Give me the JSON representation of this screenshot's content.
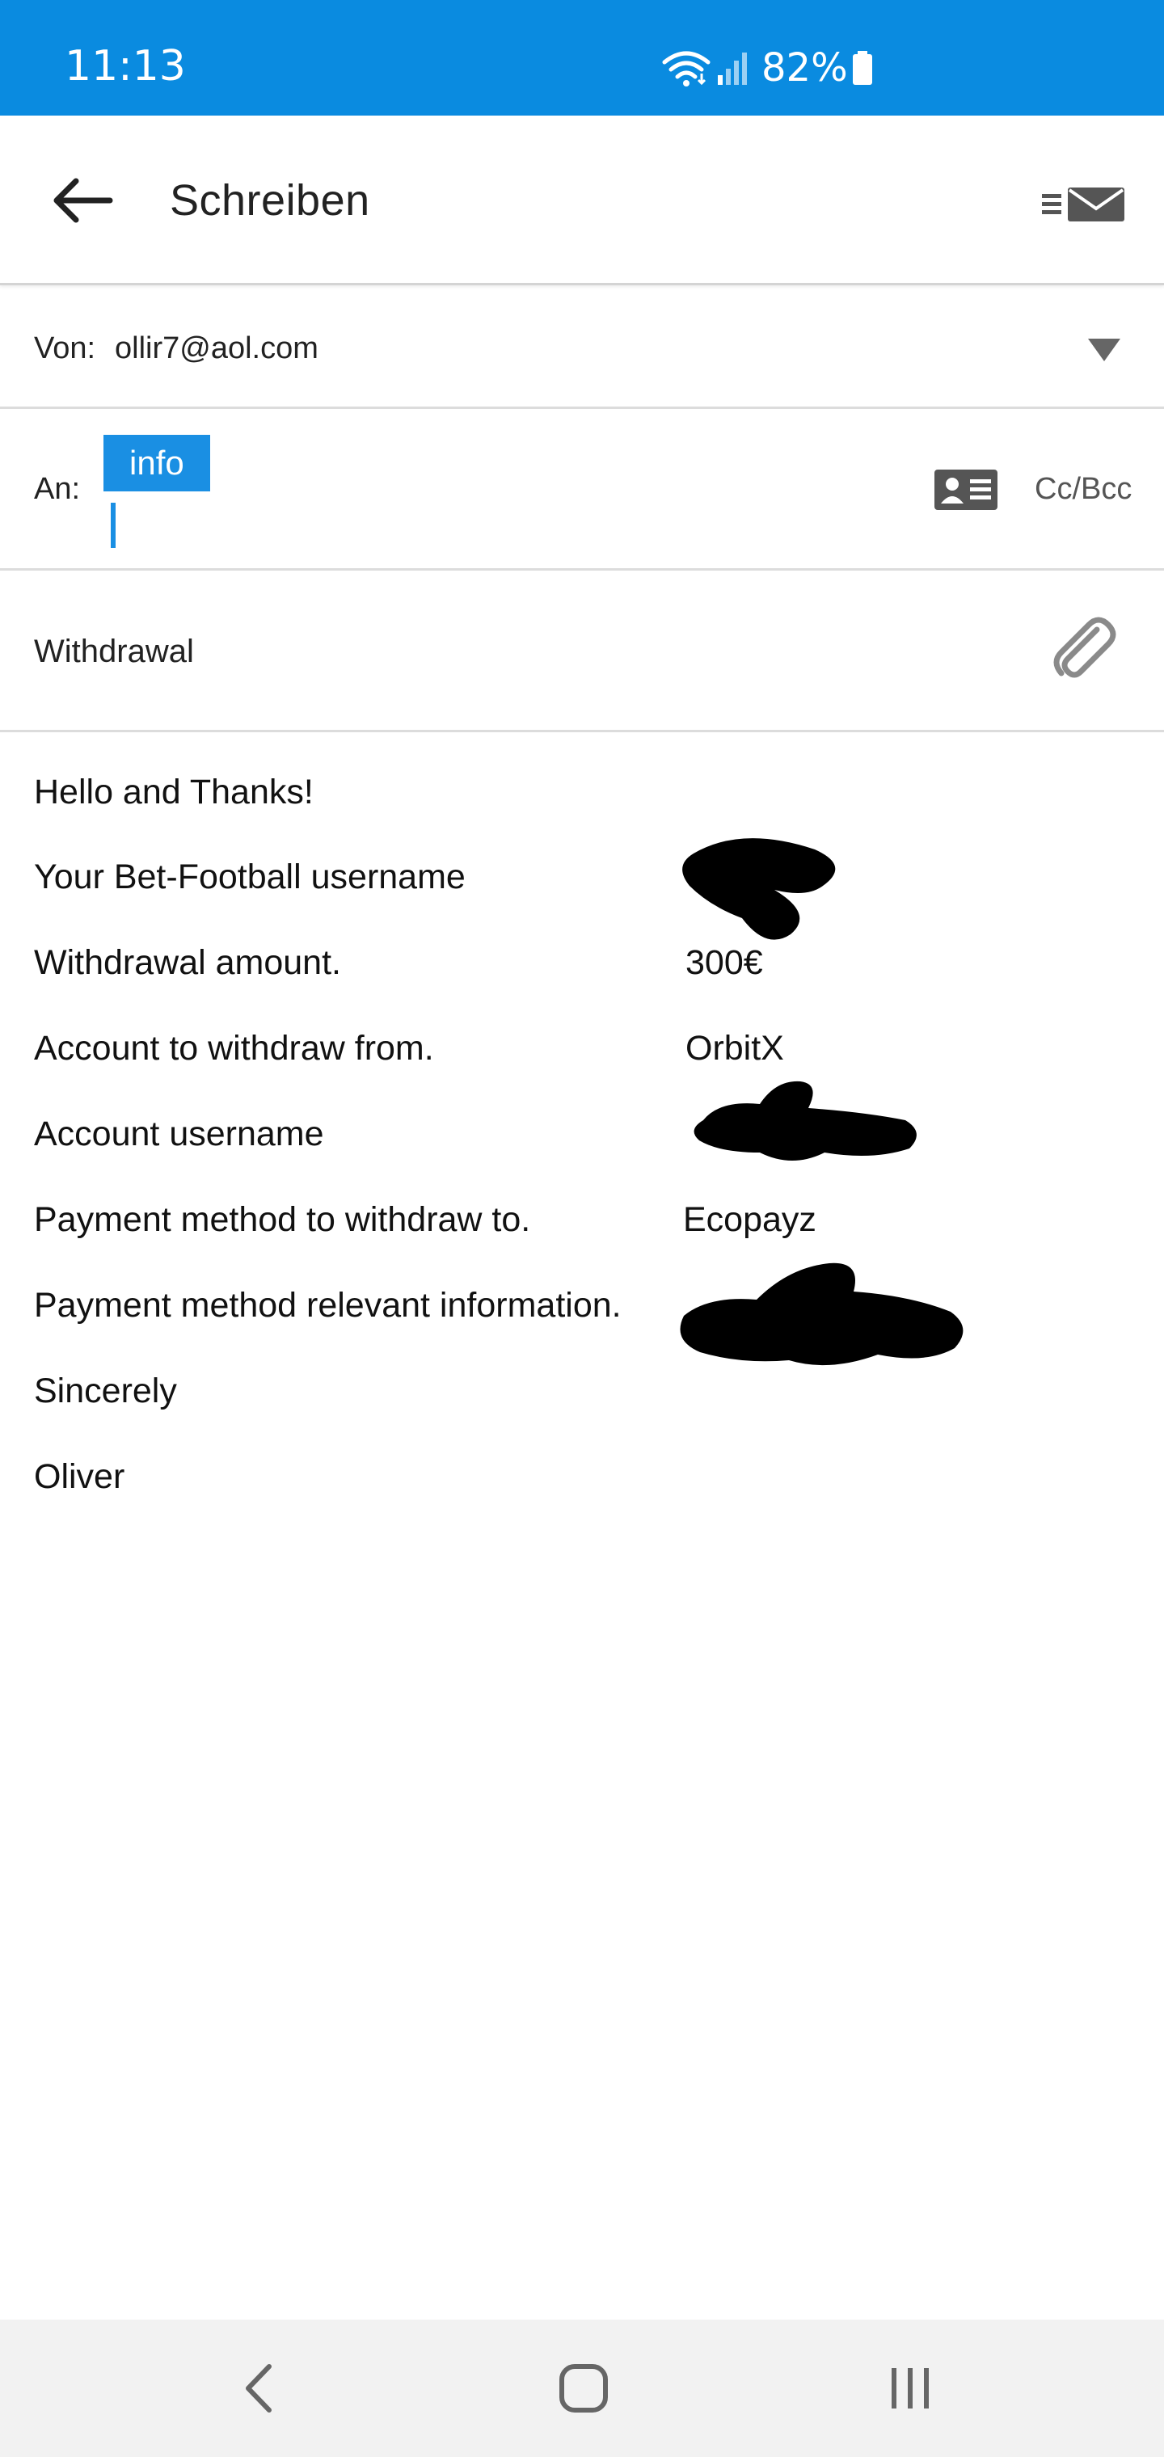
{
  "status_bar": {
    "time": "11:13",
    "battery": "82%",
    "icons": [
      "wifi-icon",
      "signal-icon",
      "battery-icon"
    ]
  },
  "app_bar": {
    "title": "Schreiben",
    "icons": [
      "back-arrow-icon",
      "mail-mode-icon"
    ]
  },
  "compose": {
    "from_label": "Von:",
    "from_value": "ollir7@aol.com",
    "to_label": "An:",
    "recipient_chip": "info",
    "cc_bcc": "Cc/Bcc",
    "subject": "Withdrawal"
  },
  "body": {
    "greeting": "Hello and Thanks!",
    "fields": [
      {
        "label": "Your Bet-Football username",
        "value": ""
      },
      {
        "label": "Withdrawal amount.",
        "value": "300€"
      },
      {
        "label": "Account to withdraw from.",
        "value": "OrbitX"
      },
      {
        "label": "Account username",
        "value": ""
      },
      {
        "label": "Payment method to withdraw to.",
        "value": "Ecopayz"
      },
      {
        "label": "Payment method relevant information.",
        "value": ""
      }
    ],
    "closing": "Sincerely",
    "signature": "Oliver"
  },
  "colors": {
    "status_bar": "#0a8be0",
    "chip": "#1a8fe3",
    "redaction": "#000000"
  }
}
